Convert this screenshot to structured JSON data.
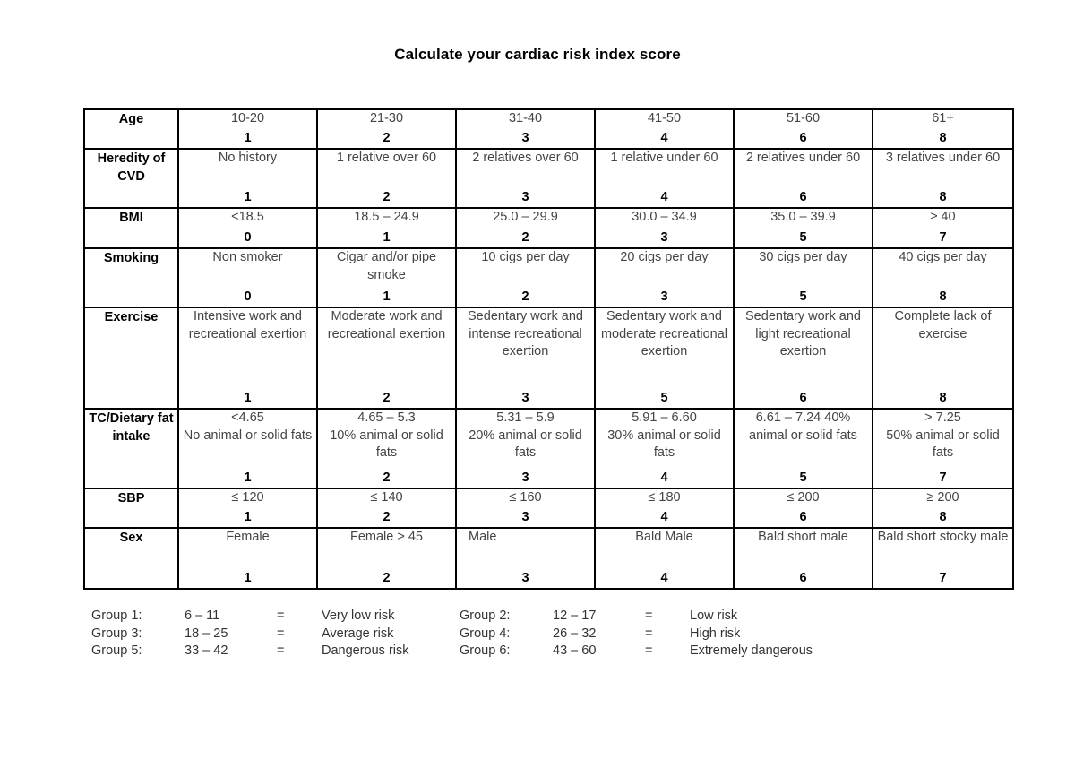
{
  "title": "Calculate your cardiac risk index score",
  "table": {
    "rows": [
      {
        "label": "Age",
        "cells": [
          {
            "desc": "10-20",
            "score": "1"
          },
          {
            "desc": "21-30",
            "score": "2"
          },
          {
            "desc": "31-40",
            "score": "3"
          },
          {
            "desc": "41-50",
            "score": "4"
          },
          {
            "desc": "51-60",
            "score": "6"
          },
          {
            "desc": "61+",
            "score": "8"
          }
        ]
      },
      {
        "label": "Heredity of CVD",
        "cells": [
          {
            "desc": "No history",
            "score": "1"
          },
          {
            "desc": "1 relative over 60",
            "score": "2"
          },
          {
            "desc": "2 relatives over 60",
            "score": "3"
          },
          {
            "desc": "1 relative under 60",
            "score": "4"
          },
          {
            "desc": "2 relatives under 60",
            "score": "6"
          },
          {
            "desc": "3 relatives under 60",
            "score": "8"
          }
        ]
      },
      {
        "label": "BMI",
        "cells": [
          {
            "desc": "<18.5",
            "score": "0"
          },
          {
            "desc": "18.5 – 24.9",
            "score": "1"
          },
          {
            "desc": "25.0 – 29.9",
            "score": "2"
          },
          {
            "desc": "30.0 – 34.9",
            "score": "3"
          },
          {
            "desc": "35.0 – 39.9",
            "score": "5"
          },
          {
            "desc": "≥ 40",
            "score": "7"
          }
        ]
      },
      {
        "label": "Smoking",
        "cells": [
          {
            "desc": "Non smoker",
            "score": "0"
          },
          {
            "desc": "Cigar and/or pipe smoke",
            "score": "1"
          },
          {
            "desc": "10 cigs per day",
            "score": "2"
          },
          {
            "desc": "20 cigs per day",
            "score": "3"
          },
          {
            "desc": "30 cigs per day",
            "score": "5"
          },
          {
            "desc": "40 cigs per day",
            "score": "8"
          }
        ]
      },
      {
        "label": "Exercise",
        "cells": [
          {
            "desc": "Intensive work and recreational exertion",
            "score": "1"
          },
          {
            "desc": "Moderate work and recreational exertion",
            "score": "2"
          },
          {
            "desc": "Sedentary work and intense recreational exertion",
            "score": "3"
          },
          {
            "desc": "Sedentary work and moderate recreational exertion",
            "score": "5"
          },
          {
            "desc": "Sedentary work and light recreational exertion",
            "score": "6"
          },
          {
            "desc": "Complete lack of exercise",
            "score": "8"
          }
        ]
      },
      {
        "label": "TC/Dietary fat intake",
        "cells": [
          {
            "desc": "<4.65\nNo animal or solid fats",
            "score": "1"
          },
          {
            "desc": "4.65 – 5.3\n10% animal or solid fats",
            "score": "2"
          },
          {
            "desc": "5.31 – 5.9\n20% animal or solid fats",
            "score": "3"
          },
          {
            "desc": "5.91 – 6.60\n30% animal or solid fats",
            "score": "4"
          },
          {
            "desc": "6.61 – 7.24  40% animal or solid fats",
            "score": "5"
          },
          {
            "desc": "> 7.25\n50% animal or solid fats",
            "score": "7"
          }
        ]
      },
      {
        "label": "SBP",
        "cells": [
          {
            "desc": "≤ 120",
            "score": "1"
          },
          {
            "desc": "≤ 140",
            "score": "2"
          },
          {
            "desc": "≤ 160",
            "score": "3"
          },
          {
            "desc": "≤ 180",
            "score": "4"
          },
          {
            "desc": "≤ 200",
            "score": "6"
          },
          {
            "desc": "≥ 200",
            "score": "8"
          }
        ]
      },
      {
        "label": "Sex",
        "cells": [
          {
            "desc": "Female",
            "score": "1"
          },
          {
            "desc": "Female > 45",
            "score": "2"
          },
          {
            "desc": "Male",
            "score": "3"
          },
          {
            "desc": "Bald Male",
            "score": "4"
          },
          {
            "desc": "Bald short male",
            "score": "6"
          },
          {
            "desc": "Bald short stocky male",
            "score": "7"
          }
        ]
      }
    ]
  },
  "legend": [
    [
      {
        "name": "Group 1:",
        "range": "6 – 11",
        "eq": "=",
        "risk": "Very low risk"
      },
      {
        "name": "Group 2:",
        "range": "12 – 17",
        "eq": "=",
        "risk": "Low risk"
      }
    ],
    [
      {
        "name": "Group 3:",
        "range": "18 – 25",
        "eq": "=",
        "risk": "Average risk"
      },
      {
        "name": "Group 4:",
        "range": "26 – 32",
        "eq": "=",
        "risk": "High risk"
      }
    ],
    [
      {
        "name": "Group 5:",
        "range": "33 – 42",
        "eq": "=",
        "risk": "Dangerous risk"
      },
      {
        "name": "Group 6:",
        "range": "43 – 60",
        "eq": "=",
        "risk": "Extremely dangerous"
      }
    ]
  ]
}
